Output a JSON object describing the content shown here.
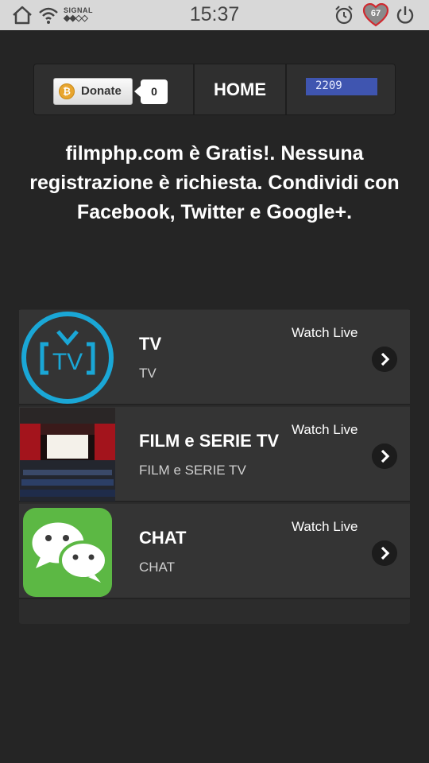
{
  "status_bar": {
    "time": "15:37",
    "signal_label": "SIGNAL",
    "battery_level": "67",
    "icons": [
      "home-icon",
      "wifi-icon",
      "signal-icon",
      "alarm-icon",
      "heart-icon",
      "power-icon"
    ]
  },
  "nav": {
    "donate_label": "Donate",
    "donate_count": "0",
    "home_label": "HOME",
    "visit_counter": "2209"
  },
  "intro_text": "filmphp.com è Gratis!. Nessuna registrazione è richiesta. Condividi con Facebook, Twitter e Google+.",
  "channels": [
    {
      "title": "TV",
      "subtitle": "TV",
      "badge": "Watch Live",
      "icon": "tv-logo-icon"
    },
    {
      "title": "FILM e SERIE TV",
      "subtitle": "FILM e SERIE TV",
      "badge": "Watch Live",
      "icon": "cinema-image"
    },
    {
      "title": "CHAT",
      "subtitle": "CHAT",
      "badge": "Watch Live",
      "icon": "chat-bubbles-icon"
    }
  ],
  "colors": {
    "background": "#252525",
    "status_bar": "#d8d8d8",
    "tv_logo": "#1aa7d6",
    "chat_green": "#5cb844",
    "counter_blue": "#3f55b0"
  }
}
